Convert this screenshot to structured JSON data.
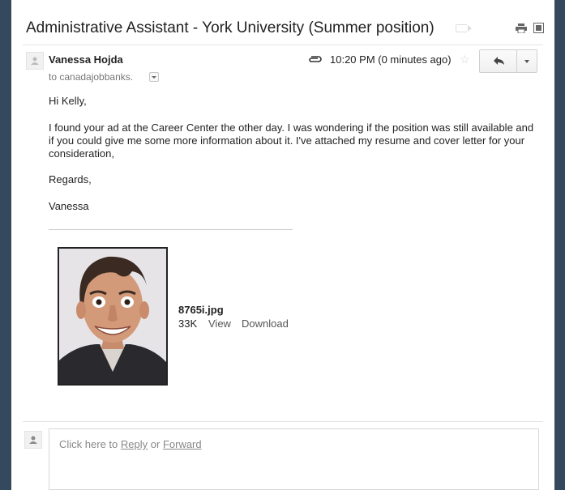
{
  "email": {
    "subject": "Administrative Assistant - York University (Summer position)",
    "sender": "Vanessa Hojda",
    "recipient": "to canadajobbanks.",
    "timestamp": "10:20 PM (0 minutes ago)",
    "greeting": "Hi Kelly,",
    "paragraph": "I found your ad at the Career Center the other day. I was wondering if the position was still available and if you could give me some more information about it. I've attached my resume and cover letter for your consideration,",
    "regards": "Regards,",
    "signoff": "Vanessa"
  },
  "attachment": {
    "filename": "8765i.jpg",
    "size": "33K",
    "view_label": "View",
    "download_label": "Download"
  },
  "reply_box": {
    "prefix": "Click here to",
    "reply_link": "Reply",
    "or": "or",
    "forward_link": "Forward"
  },
  "icons": {
    "attachment": "paperclip-icon",
    "star": "star-icon",
    "reply": "reply-arrow-icon",
    "more": "chevron-down-icon",
    "print": "print-icon",
    "new_window": "new-window-icon",
    "label": "label-tag-icon",
    "avatar": "person-icon"
  },
  "colors": {
    "frame": "#34495e",
    "background": "#ffffff",
    "text": "#222222",
    "muted": "#777777"
  }
}
